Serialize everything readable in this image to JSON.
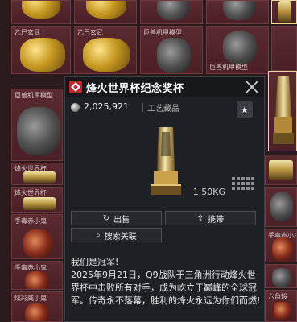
{
  "background_grid": {
    "labels": {
      "row1_a": "乙巳玄武",
      "row1_b": "乙巳玄武",
      "row1_c": "巨兽机甲模型",
      "row2_c": "巨兽机甲模型",
      "row3_a": "巨兽机甲模型",
      "row4_a": "烽火世界杯",
      "row5_a": "烽火世界杯",
      "row6_a": "手毒赤小鬼",
      "row6_r": "手毒赤小鬼",
      "row7_a": "手毒赤小鬼",
      "row8_a": "炫彩威小鬼",
      "row8_r": "六角骰"
    }
  },
  "popup": {
    "title": "烽火世界杯纪念奖杯",
    "price": "2,025,921",
    "category": "工艺藏品",
    "weight": "1.50KG",
    "buttons": {
      "sell": "出售",
      "carry": "携带",
      "search": "搜索关联"
    },
    "description": [
      "我们是冠军!",
      "2025年9月21日，Q9战队于三角洲行动烽火世界杯中击败所有对手，成为屹立于巅峰的全球冠军。传奇永不落幕，胜利的烽火永远为你们而燃!"
    ]
  },
  "icons": {
    "badge": "red-diamond-icon",
    "close": "close-icon",
    "favorite": "star-icon",
    "coin": "coin-icon",
    "sell": "sell-icon",
    "carry": "upload-icon",
    "search": "search-icon"
  }
}
